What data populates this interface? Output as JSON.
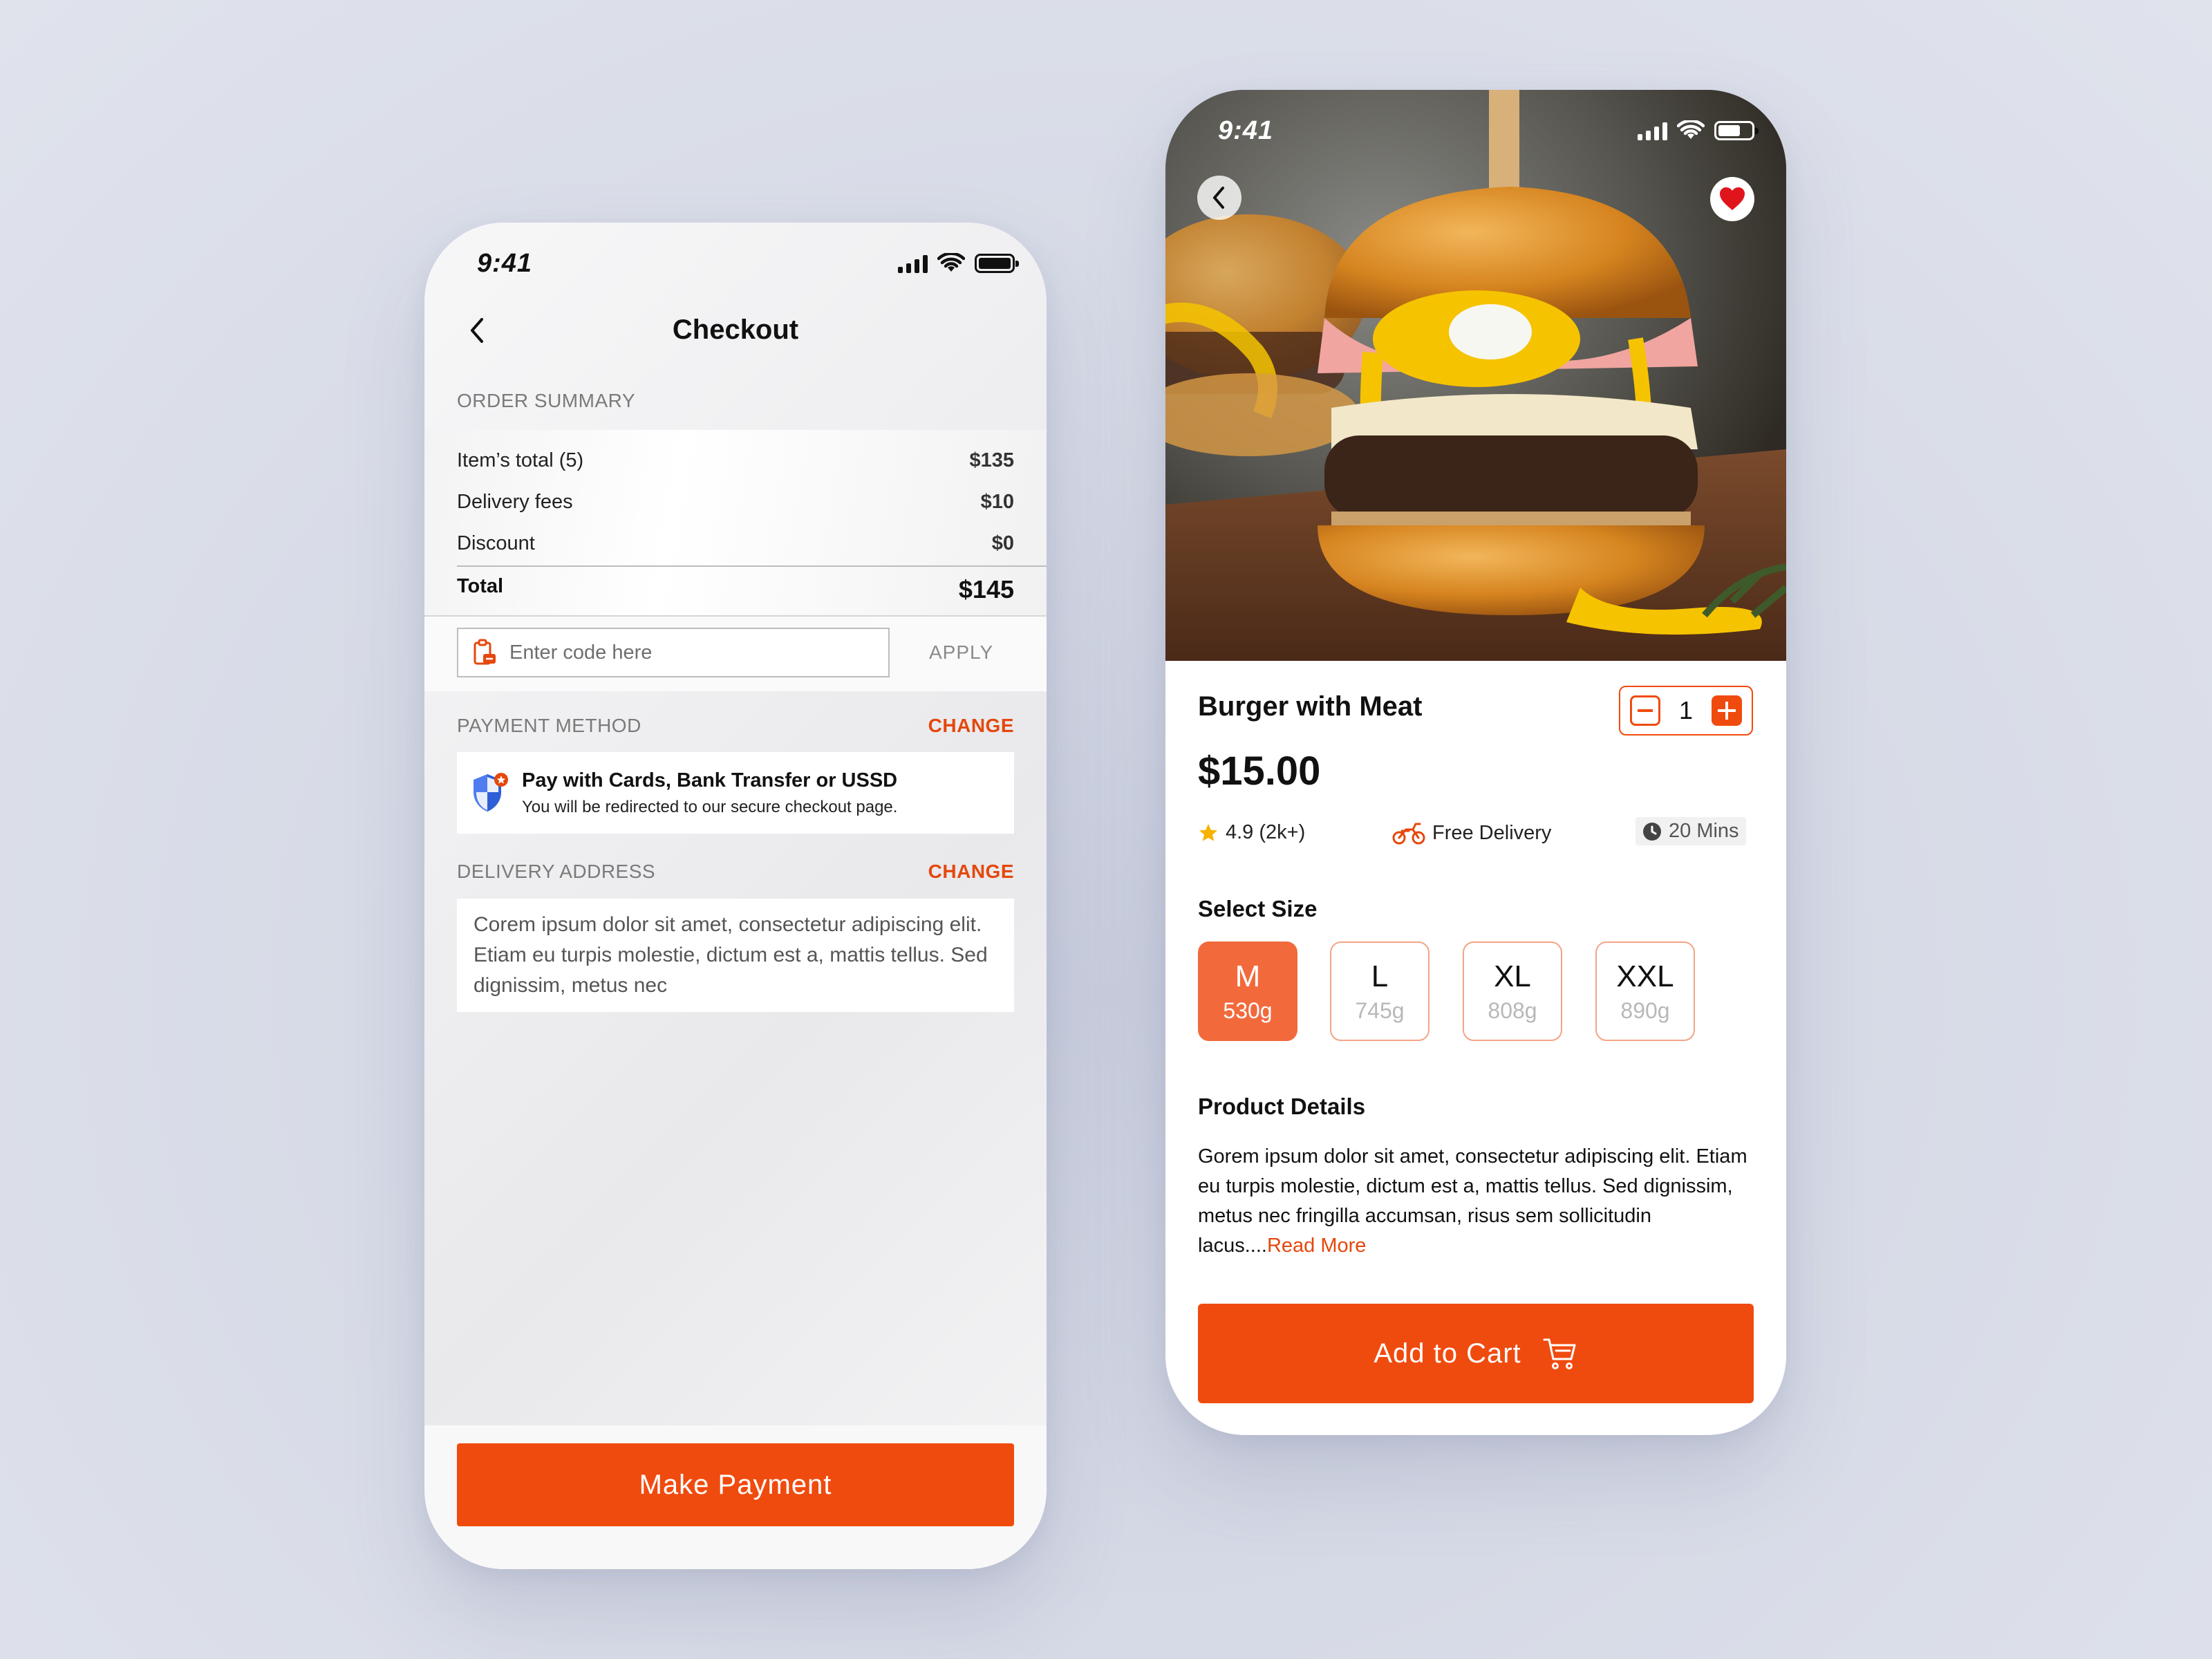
{
  "checkout": {
    "status_time": "9:41",
    "title": "Checkout",
    "order_summary_label": "ORDER SUMMARY",
    "rows": [
      {
        "label": "Item’s total (5)",
        "value": "$135"
      },
      {
        "label": "Delivery fees",
        "value": "$10"
      },
      {
        "label": "Discount",
        "value": "$0"
      }
    ],
    "total": {
      "label": "Total",
      "value": "$145"
    },
    "promo": {
      "placeholder": "Enter code here",
      "apply": "APPLY"
    },
    "payment": {
      "label": "PAYMENT METHOD",
      "change": "CHANGE",
      "title": "Pay with Cards, Bank Transfer or USSD",
      "subtitle": "You will be redirected to our secure checkout page."
    },
    "delivery": {
      "label": "DELIVERY ADDRESS",
      "change": "CHANGE",
      "address": "Corem ipsum dolor sit amet, consectetur adipiscing elit. Etiam eu turpis molestie, dictum est a, mattis tellus. Sed dignissim, metus nec"
    },
    "make_payment": "Make Payment"
  },
  "product": {
    "status_time": "9:41",
    "name": "Burger with Meat",
    "quantity": "1",
    "price": "$15.00",
    "rating": "4.9 (2k+)",
    "delivery": "Free Delivery",
    "time": "20 Mins",
    "select_size_label": "Select Size",
    "sizes": [
      {
        "size": "M",
        "weight": "530g",
        "selected": true
      },
      {
        "size": "L",
        "weight": "745g",
        "selected": false
      },
      {
        "size": "XL",
        "weight": "808g",
        "selected": false
      },
      {
        "size": "XXL",
        "weight": "890g",
        "selected": false
      }
    ],
    "details_label": "Product Details",
    "details_text": "Gorem ipsum dolor sit amet, consectetur adipiscing elit. Etiam eu turpis molestie, dictum est a, mattis tellus. Sed dignissim, metus nec fringilla accumsan, risus sem sollicitudin lacus....",
    "read_more": "Read More",
    "add_to_cart": "Add to Cart"
  },
  "colors": {
    "accent": "#f04b0e",
    "background": "#d6dae6"
  },
  "icons": [
    "back-icon",
    "signal-icon",
    "wifi-icon",
    "battery-icon",
    "coupon-icon",
    "shield-icon",
    "heart-icon",
    "star-icon",
    "scooter-icon",
    "clock-icon",
    "cart-icon"
  ]
}
